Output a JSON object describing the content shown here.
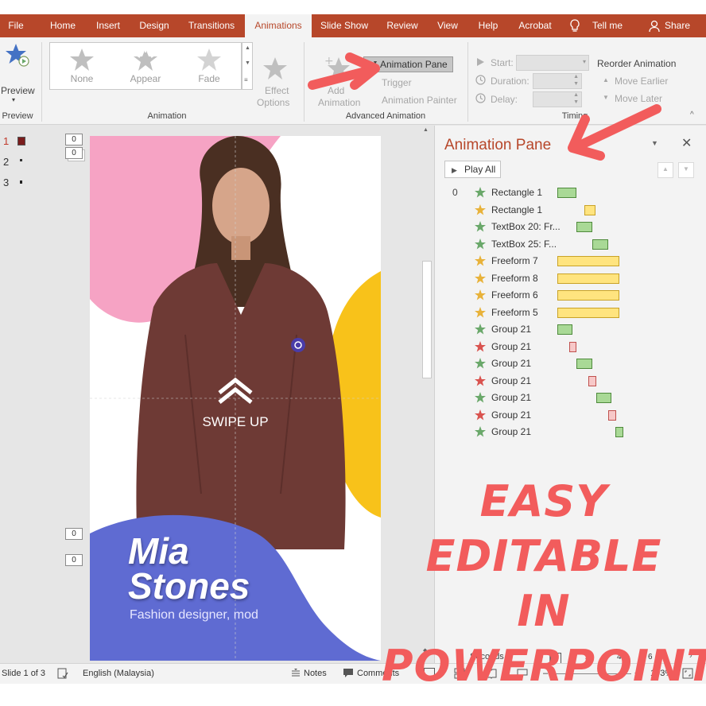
{
  "tabs": [
    "File",
    "Home",
    "Insert",
    "Design",
    "Transitions",
    "Animations",
    "Slide Show",
    "Review",
    "View",
    "Help",
    "Acrobat"
  ],
  "active_tab": "Animations",
  "tellme": "Tell me",
  "share": "Share",
  "ribbon": {
    "preview": "Preview",
    "preview_group": "Preview",
    "animation_group": "Animation",
    "gallery": [
      "None",
      "Appear",
      "Fade"
    ],
    "effect_options": [
      "Effect",
      "Options"
    ],
    "add_animation": [
      "Add",
      "Animation"
    ],
    "trigger": "Trigger",
    "animation_pane_btn": "Animation Pane",
    "animation_painter": "Animation Painter",
    "advanced_group": "Advanced Animation",
    "start": "Start:",
    "duration": "Duration:",
    "delay": "Delay:",
    "timing_group": "Timing",
    "reorder": "Reorder Animation",
    "move_earlier": "Move Earlier",
    "move_later": "Move Later"
  },
  "thumbs": [
    "1",
    "2",
    "3"
  ],
  "slide": {
    "swipe": "SWIPE UP",
    "name_line1": "Mia",
    "name_line2": "Stones",
    "subtitle": "Fashion designer, mod"
  },
  "zero": "0",
  "pane": {
    "title": "Animation Pane",
    "play_all": "Play All",
    "rows": [
      {
        "num": "0",
        "name": "Rectangle 1",
        "color": "green",
        "bar_start": 0,
        "bar_len": 24
      },
      {
        "num": "",
        "name": "Rectangle 1",
        "color": "yellow",
        "bar_start": 34,
        "bar_len": 14
      },
      {
        "num": "",
        "name": "TextBox 20: Fr...",
        "color": "green",
        "bar_start": 24,
        "bar_len": 20
      },
      {
        "num": "",
        "name": "TextBox 25: F...",
        "color": "green",
        "bar_start": 44,
        "bar_len": 20
      },
      {
        "num": "",
        "name": "Freeform 7",
        "color": "yellow",
        "bar_start": 0,
        "bar_len": 78
      },
      {
        "num": "",
        "name": "Freeform 8",
        "color": "yellow",
        "bar_start": 0,
        "bar_len": 78
      },
      {
        "num": "",
        "name": "Freeform 6",
        "color": "yellow",
        "bar_start": 0,
        "bar_len": 78
      },
      {
        "num": "",
        "name": "Freeform 5",
        "color": "yellow",
        "bar_start": 0,
        "bar_len": 78
      },
      {
        "num": "",
        "name": "Group 21",
        "color": "green",
        "bar_start": 0,
        "bar_len": 19
      },
      {
        "num": "",
        "name": "Group 21",
        "color": "red",
        "bar_start": 15,
        "bar_len": 9
      },
      {
        "num": "",
        "name": "Group 21",
        "color": "green",
        "bar_start": 24,
        "bar_len": 20
      },
      {
        "num": "",
        "name": "Group 21",
        "color": "red",
        "bar_start": 39,
        "bar_len": 10
      },
      {
        "num": "",
        "name": "Group 21",
        "color": "green",
        "bar_start": 49,
        "bar_len": 19
      },
      {
        "num": "",
        "name": "Group 21",
        "color": "red",
        "bar_start": 64,
        "bar_len": 10
      },
      {
        "num": "",
        "name": "Group 21",
        "color": "green",
        "bar_start": 73,
        "bar_len": 10
      }
    ],
    "seconds": "Seconds",
    "ticks": [
      "0",
      "2",
      "4",
      "6"
    ]
  },
  "status": {
    "slide": "Slide 1 of 3",
    "lang": "English (Malaysia)",
    "notes": "Notes",
    "comments": "Comments",
    "zoom": "193%"
  },
  "overlay": {
    "line1": "EASY EDITABLE",
    "line2": "IN",
    "line3": "POWERPOINT"
  },
  "colors": {
    "accent": "#b7472a",
    "entrance": "#6aa86a",
    "emphasis": "#e8b23a",
    "exit": "#d9534f",
    "overlay": "#f25c5c"
  }
}
